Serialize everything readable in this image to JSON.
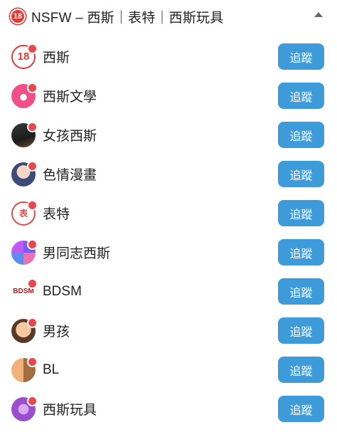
{
  "header": {
    "badge": "18",
    "title": "NSFW – 西斯｜表特｜西斯玩具"
  },
  "items": [
    {
      "name": "西斯",
      "avatar_text": "18",
      "avatar_icon": "no-18-icon",
      "button": "追蹤"
    },
    {
      "name": "西斯文學",
      "avatar_text": "",
      "avatar_icon": "heart-book-icon",
      "button": "追蹤"
    },
    {
      "name": "女孩西斯",
      "avatar_text": "",
      "avatar_icon": "girl-silhouette-icon",
      "button": "追蹤"
    },
    {
      "name": "色情漫畫",
      "avatar_text": "",
      "avatar_icon": "anime-girl-icon",
      "button": "追蹤"
    },
    {
      "name": "表特",
      "avatar_text": "表",
      "avatar_icon": "beauty-stamp-icon",
      "button": "追蹤"
    },
    {
      "name": "男同志西斯",
      "avatar_text": "",
      "avatar_icon": "rainbow-couple-icon",
      "button": "追蹤"
    },
    {
      "name": "BDSM",
      "avatar_text": "BDSM",
      "avatar_icon": "bdsm-handcuff-icon",
      "button": "追蹤"
    },
    {
      "name": "男孩",
      "avatar_text": "",
      "avatar_icon": "boy-face-icon",
      "button": "追蹤"
    },
    {
      "name": "BL",
      "avatar_text": "",
      "avatar_icon": "two-boys-icon",
      "button": "追蹤"
    },
    {
      "name": "西斯玩具",
      "avatar_text": "",
      "avatar_icon": "toy-icon",
      "button": "追蹤"
    }
  ]
}
